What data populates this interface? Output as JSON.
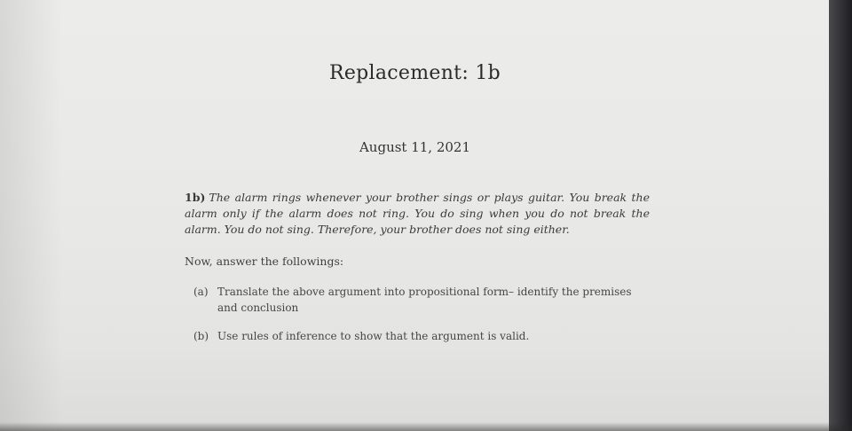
{
  "document": {
    "title": "Replacement: 1b",
    "date": "August 11, 2021",
    "problem_label": "1b)",
    "problem_text": "The alarm rings whenever your brother sings or plays guitar. You break the alarm only if the alarm does not ring. You do sing when you do not break the alarm. You do not sing. Therefore, your brother does not sing either.",
    "instruction": "Now, answer the followings:",
    "parts": [
      {
        "marker": "(a)",
        "text_line1": "Translate the above argument into propositional form– identify the premises",
        "text_line2": "and conclusion"
      },
      {
        "marker": "(b)",
        "text_line1": "Use rules of inference to show that the argument is valid."
      }
    ]
  }
}
